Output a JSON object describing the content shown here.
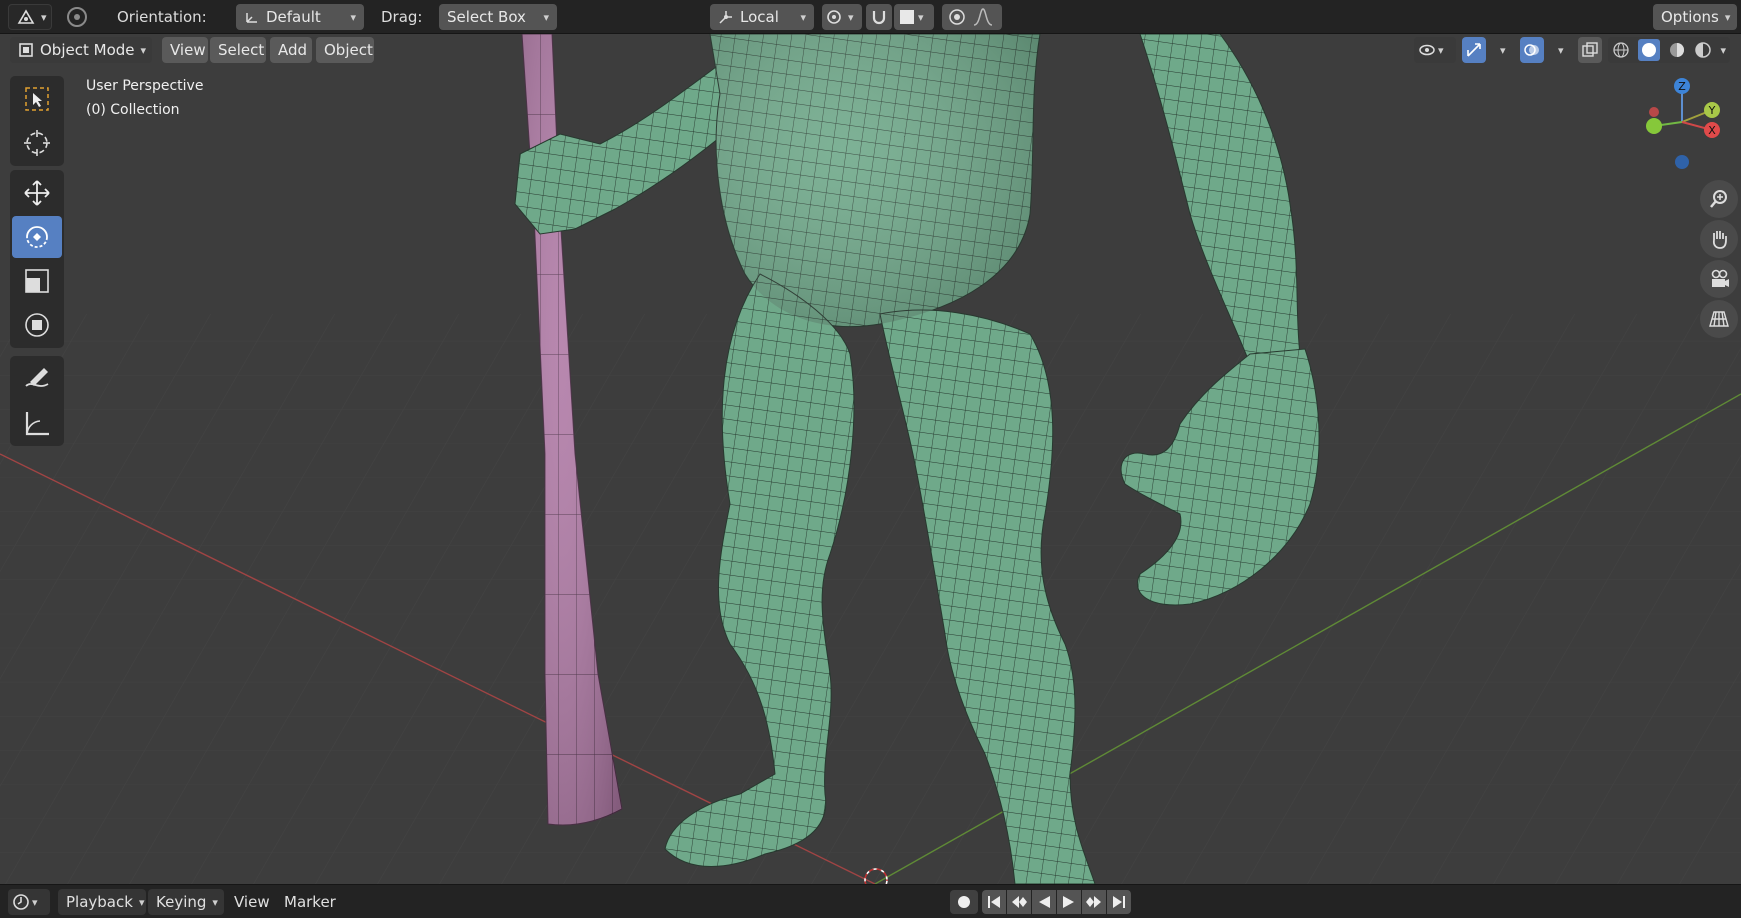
{
  "header": {
    "editor_type_icon": "editor-type-icon",
    "orientation_label": "Orientation:",
    "orientation_value": "Default",
    "drag_label": "Drag:",
    "drag_value": "Select Box",
    "pivot_value": "Local",
    "options_label": "Options"
  },
  "viewport_header": {
    "mode": "Object Mode",
    "menus": [
      "View",
      "Select",
      "Add",
      "Object"
    ]
  },
  "overlay": {
    "view_name": "User Perspective",
    "collection": "(0) Collection"
  },
  "gizmo": {
    "z": "Z",
    "y": "Y",
    "x": "X"
  },
  "tools": [
    "select-box-icon",
    "cursor-icon",
    "move-icon",
    "rotate-icon",
    "scale-icon",
    "transform-icon",
    "annotate-icon",
    "measure-icon"
  ],
  "active_tool": "rotate-icon",
  "nav_buttons": [
    "zoom-icon",
    "pan-hand-icon",
    "camera-icon",
    "grid-icon"
  ],
  "timeline": {
    "playback": "Playback",
    "keying": "Keying",
    "view": "View",
    "marker": "Marker"
  },
  "colors": {
    "accent": "#5680c2",
    "body_mesh": "#6fa98a",
    "staff_mesh": "#b07aa6",
    "axis_x": "#c04848",
    "axis_y": "#6c9a3c"
  }
}
